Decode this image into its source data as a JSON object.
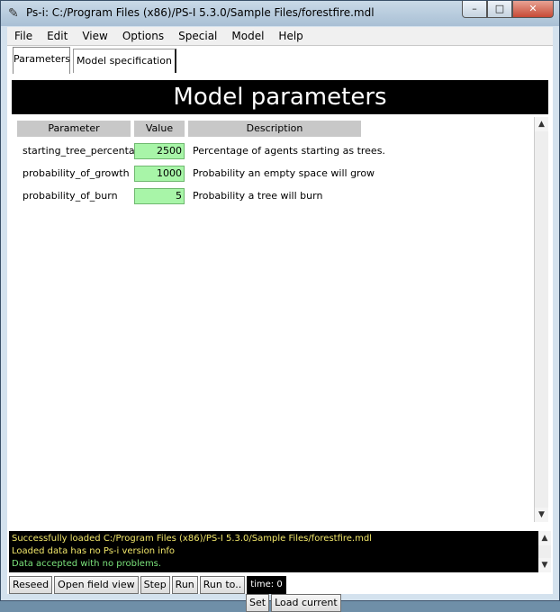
{
  "window": {
    "title": "Ps-i: C:/Program Files (x86)/PS-I 5.3.0/Sample Files/forestfire.mdl",
    "min_label": "–",
    "max_label": "□",
    "close_label": "✕"
  },
  "menu": [
    "File",
    "Edit",
    "View",
    "Options",
    "Special",
    "Model",
    "Help"
  ],
  "tabs": [
    "Parameters",
    "Model specification"
  ],
  "header": {
    "title": "Model parameters"
  },
  "table": {
    "columns": [
      "Parameter",
      "Value",
      "Description"
    ],
    "rows": [
      {
        "param": "starting_tree_percentage",
        "value": "2500",
        "desc": "Percentage of agents starting as trees."
      },
      {
        "param": "probability_of_growth",
        "value": "1000",
        "desc": "Probability an empty space will grow"
      },
      {
        "param": "probability_of_burn",
        "value": "5",
        "desc": "Probability a tree will burn"
      }
    ]
  },
  "buttons": {
    "set": "Set",
    "load_current": "Load current"
  },
  "console": [
    {
      "text": "Successfully loaded C:/Program Files (x86)/PS-I 5.3.0/Sample Files/forestfire.mdl",
      "color": "#f2e76a"
    },
    {
      "text": "Loaded data has no Ps-i version info",
      "color": "#f2e76a"
    },
    {
      "text": "Data accepted with no problems.",
      "color": "#7be37b"
    }
  ],
  "statusbar": {
    "reseed": "Reseed",
    "open_field_view": "Open field view",
    "step": "Step",
    "run": "Run",
    "run_to": "Run to..",
    "time": "time: 0"
  },
  "icons": {
    "app": "feather-icon",
    "scroll_up": "up-arrow-icon",
    "scroll_down": "down-arrow-icon"
  }
}
